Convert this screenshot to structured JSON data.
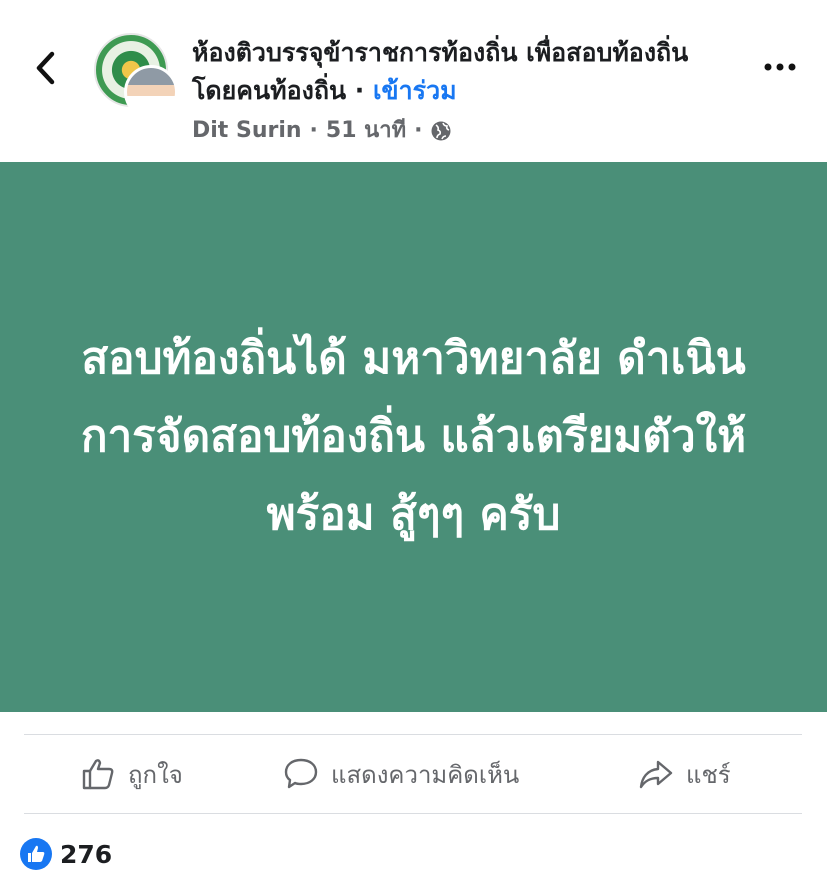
{
  "header": {
    "group_name": "ห้องติวบรรจุข้าราชการท้องถิ่น เพื่อสอบท้องถิ่น โดยคนท้องถิ่น",
    "separator": " · ",
    "join_label": "เข้าร่วม",
    "author": "Dit Surin",
    "time": "51 นาที",
    "dot": "·"
  },
  "post": {
    "text": "สอบท้องถิ่นได้ มหาวิทยาลัย ดำเนินการจัดสอบท้องถิ่น แล้วเตรียมตัวให้พร้อม สู้ๆๆ ครับ",
    "background_color": "#4a8f78"
  },
  "actions": {
    "like_label": "ถูกใจ",
    "comment_label": "แสดงความคิดเห็น",
    "share_label": "แชร์"
  },
  "reactions": {
    "count": "276"
  }
}
